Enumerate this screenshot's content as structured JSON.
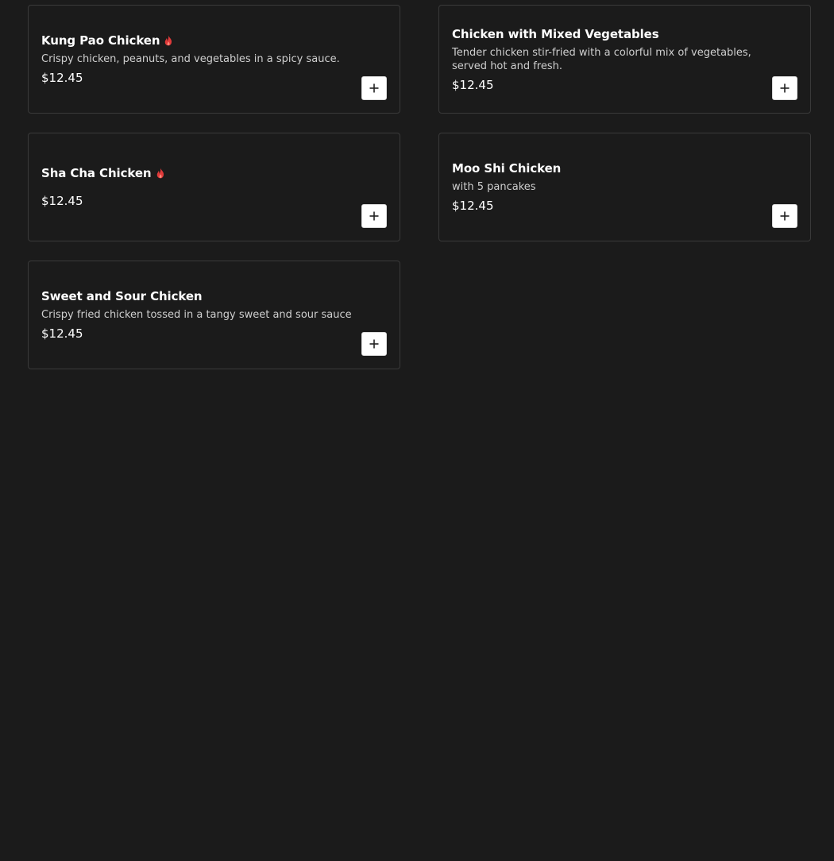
{
  "menu": {
    "items": [
      {
        "name": "Kung Pao Chicken",
        "spicy": true,
        "description": "Crispy chicken, peanuts, and vegetables in a spicy sauce.",
        "price": "$12.45",
        "add_icon": "plus-icon"
      },
      {
        "name": "Chicken with Mixed Vegetables",
        "spicy": false,
        "description": "Tender chicken stir-fried with a colorful mix of vegetables, served hot and fresh.",
        "price": "$12.45",
        "add_icon": "plus-icon"
      },
      {
        "name": "Sha Cha Chicken",
        "spicy": true,
        "description": "",
        "price": "$12.45",
        "add_icon": "plus-icon"
      },
      {
        "name": "Moo Shi Chicken",
        "spicy": false,
        "description": "with 5 pancakes",
        "price": "$12.45",
        "add_icon": "plus-icon"
      },
      {
        "name": "Sweet and Sour Chicken",
        "spicy": false,
        "description": "Crispy fried chicken tossed in a tangy sweet and sour sauce",
        "price": "$12.45",
        "add_icon": "plus-icon"
      }
    ]
  },
  "colors": {
    "background": "#1b1b1b",
    "card_border": "#3a3a3a",
    "spicy_icon": "#e03a3a",
    "button_bg": "#ffffff"
  }
}
